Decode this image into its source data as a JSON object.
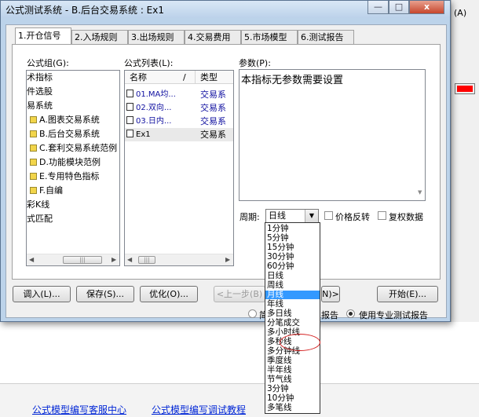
{
  "background": {
    "right_label": "(A)",
    "red_swatch": "#ff0000",
    "links": [
      "公式模型编写客服中心",
      "公式模型编写调试教程"
    ]
  },
  "window": {
    "title": "公式测试系统 - B.后台交易系统 : Ex1",
    "minimize_glyph": "—",
    "maximize_glyph": "□",
    "close_glyph": "x"
  },
  "tabs": [
    "1.开仓信号",
    "2.入场规则",
    "3.出场规则",
    "4.交易费用",
    "5.市场模型",
    "6.测试报告"
  ],
  "formula_group": {
    "label": "公式组(G):",
    "items": [
      {
        "text": "术指标",
        "folder": false
      },
      {
        "text": "件选股",
        "folder": false
      },
      {
        "text": "易系统",
        "folder": false
      },
      {
        "text": "A.图表交易系统",
        "folder": true
      },
      {
        "text": "B.后台交易系统",
        "folder": true
      },
      {
        "text": "C.套利交易系统范例",
        "folder": true
      },
      {
        "text": "D.功能模块范例",
        "folder": true
      },
      {
        "text": "E.专用特色指标",
        "folder": true
      },
      {
        "text": "F.自编",
        "folder": true
      },
      {
        "text": "彩K线",
        "folder": false
      },
      {
        "text": "式匹配",
        "folder": false
      }
    ]
  },
  "formula_list": {
    "label": "公式列表(L):",
    "col_name": "名称",
    "col_sep": "/",
    "col_type": "类型",
    "rows": [
      {
        "name": "01.MA均...",
        "type": "交易系"
      },
      {
        "name": "02.双向...",
        "type": "交易系"
      },
      {
        "name": "03.日内...",
        "type": "交易系"
      },
      {
        "name": "Ex1",
        "type": "交易系"
      }
    ]
  },
  "params": {
    "label": "参数(P):",
    "text": "本指标无参数需要设置"
  },
  "period": {
    "label": "周期:",
    "value": "日线",
    "options": [
      "1分钟",
      "5分钟",
      "15分钟",
      "30分钟",
      "60分钟",
      "日线",
      "周线",
      "月线",
      "年线",
      "多日线",
      "分笔成交",
      "多小时线",
      "多秒线",
      "多分钟线",
      "季度线",
      "半年线",
      "节气线",
      "3分钟",
      "10分钟",
      "多笔线"
    ],
    "selected_index": 7
  },
  "checkboxes": {
    "price_reverse": "价格反转",
    "adjust_data": "复权数据"
  },
  "buttons": {
    "import": "调入(L)...",
    "save": "保存(S)...",
    "optimize": "优化(O)...",
    "prev": "<上一步(B)",
    "next": "N)>",
    "start": "开始(E)..."
  },
  "report": {
    "option_a": "简",
    "option_a_suffix": "报告",
    "option_b": "使用专业测试报告"
  },
  "colors": {
    "title_bar": "#c9dcf0",
    "selection": "#3399ff",
    "list_text": "#1010a0",
    "annotation": "#d42020"
  }
}
